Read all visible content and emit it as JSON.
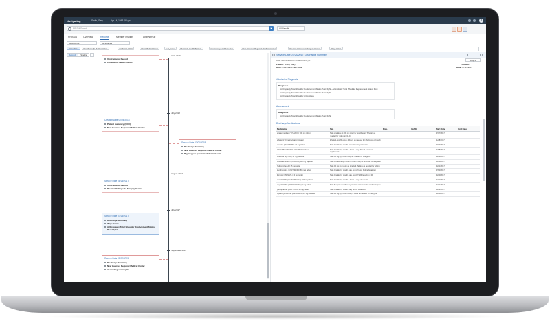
{
  "topbar": {
    "logo": "Navigating",
    "user": "Smith, Gary",
    "date": "Apr 14, 1963 (54 yrs)"
  },
  "search": {
    "placeholder": "PRISM Search",
    "results_select": "All Results"
  },
  "app_tabs": [
    "PRISMA",
    "Overview",
    "Records",
    "Member Insights",
    "Analyst Hub"
  ],
  "filters": {
    "records_select": "All Records",
    "sources_select": "All Sources"
  },
  "facilities": [
    "All Facilities",
    "Westborough Medical Clinic",
    "California Clinic",
    "West Medical Clinic",
    "test_name",
    "Riverside Health System",
    "Community Health Center",
    "New Hanover Regional Medical Center",
    "Premier Orthopedic Surgery Center",
    "Ways Clinic"
  ],
  "view_toggle": {
    "records": "Records",
    "timeline": "Timeline"
  },
  "timeline": {
    "months": [
      "April 2020",
      "July 2018",
      "August 2017",
      "July 2017",
      "September 2015"
    ],
    "cards": [
      {
        "title": "",
        "items": [
          "Unstructured Record",
          "Community Health Center"
        ]
      },
      {
        "title": "Creation Date 07/06/2018",
        "items": [
          "Patient Summary (CCD)",
          "New Hanover Regional Medical Center"
        ]
      },
      {
        "title": "Service Date 07/01/2018",
        "items": [
          "Discharge Summary",
          "New Hanover Regional Medical Center",
          "Right upper quadrant abdominal pain"
        ]
      },
      {
        "title": "Service Date 08/24/2017",
        "items": [
          "Unstructured Record",
          "Premier Orthopedic Surgery Center"
        ]
      },
      {
        "title": "Service Date 07/24/2017",
        "items": [
          "Discharge Summary",
          "Ways Clinic",
          "Arthroplasty Total Shoulder Replacement Status Post Right"
        ]
      },
      {
        "title": "Service Date 09/10/2015",
        "items": [
          "Discharge Summary",
          "New Hanover Regional Medical Center",
          "Ascending cholangitis"
        ]
      }
    ]
  },
  "document": {
    "title": "Service Date 07/24/2017: Discharge Summary",
    "subtitle": "Date last reviewed: Not accessed yet",
    "jump_button": "Jump to",
    "patient_label": "Patient:",
    "patient_value": "Smith, Gary",
    "dob_label": "DOB:",
    "dob_value": "04/14/1963",
    "sex_label": "Sex:",
    "sex_value": "Male",
    "provider_label": "Provider:",
    "date_label": "Date:",
    "date_value": "07/24/2017",
    "admission_title": "Admission Diagnosis",
    "admission_label": "Diagnosis",
    "admission_lines": [
      "Arthroplasty Total Shoulder Replacement Status Post Right - Arthroplasty Total Shoulder Replacement Status Post",
      "Arthroplasty Total Shoulder Replacement Status Post Right",
      "Arthroplasty Total Shoulder Arthroplasty"
    ],
    "assessment_title": "Assessment",
    "assessment_label": "Diagnosis",
    "assessment_lines": [
      "Arthroplasty Total Shoulder Replacement Status Post Right"
    ],
    "meds_title": "Discharge Medications",
    "med_headers": [
      "Medication",
      "Sig.",
      "Disp.",
      "Refills",
      "Start Date",
      "End Date"
    ],
    "medications": [
      {
        "name": "acetaminophen (TYLENOL) 500 mg tablet",
        "sig": "Take 2 tablets (1,000 mg total) by mouth every 6 hours as needed for mild pain (1-3)",
        "start": "07/27/2017"
      },
      {
        "name": "albuterol 90 mcg/actuation inhaler",
        "sig": "Inhale 1-2 puffs every 4 hours as needed for shortness of breath",
        "start": "11/28/2017"
      },
      {
        "name": "atenolol (TENORMIN) 25 mg tablet",
        "sig": "Take 1 tablet by mouth at bedtime. Hypertension",
        "start": "07/27/2017"
      },
      {
        "name": "CALCIUM CITRATE-VITAMIN D3 tablet",
        "sig": "Take 1 tablet by mouth 2 times a day. Take 2 gummies supplement",
        "start": "06/08/2017"
      },
      {
        "name": "cetirizine (ZyrTEC) 10 mg capsule",
        "sig": "Take 10 mg by mouth daily as needed for allergies.",
        "start": "06/29/2017"
      },
      {
        "name": "docusate sodium (COLACE) 100 mg capsule",
        "sig": "Take 1 capsule by mouth 2 times a day as directed. Constipation",
        "start": "08/28/2017"
      },
      {
        "name": "hydroxyzine HCl 25 mg tablet",
        "sig": "Take 10 mg by mouth as directed. Tablets as needed for itching",
        "start": "06/21/2017"
      },
      {
        "name": "levothyroxine (SYNTHROID) 50 mcg tablet",
        "sig": "Take 1 tablet by mouth daily. Hypothyroid before breakfast",
        "start": "07/03/2017"
      },
      {
        "name": "lisinopril (PRINIVIL) 10 mg tablet",
        "sig": "Take 1 tablet by mouth daily. Hold if SBP less than 100",
        "start": "06/20/2017"
      },
      {
        "name": "metFORMIN (GLUCOPHAGE) 500 mg tablet",
        "sig": "Take 1 tablet by mouth 2 times a day with meals",
        "start": "06/22/2017"
      },
      {
        "name": "oxyCODONE (ROXICODONE) 5 mg tablet",
        "sig": "Take 5 mg by mouth every 4 hours as needed for moderate pain",
        "start": "06/21/2017"
      },
      {
        "name": "pantoprazole (PROTONIX) 40 mg tablet",
        "sig": "Take 1 tablet by mouth daily before breakfast",
        "start": "06/22/2017"
      },
      {
        "name": "diphenhydrAMINE (BENADRYL) 25 mg capsule",
        "sig": "Take 25 mg by mouth every 6 hours as needed for allergies.",
        "start": "10/08/2017"
      }
    ]
  },
  "colors": {
    "topbar": "#2a3b4c",
    "accent": "#2f6db3",
    "card_border": "#e09a9a"
  }
}
